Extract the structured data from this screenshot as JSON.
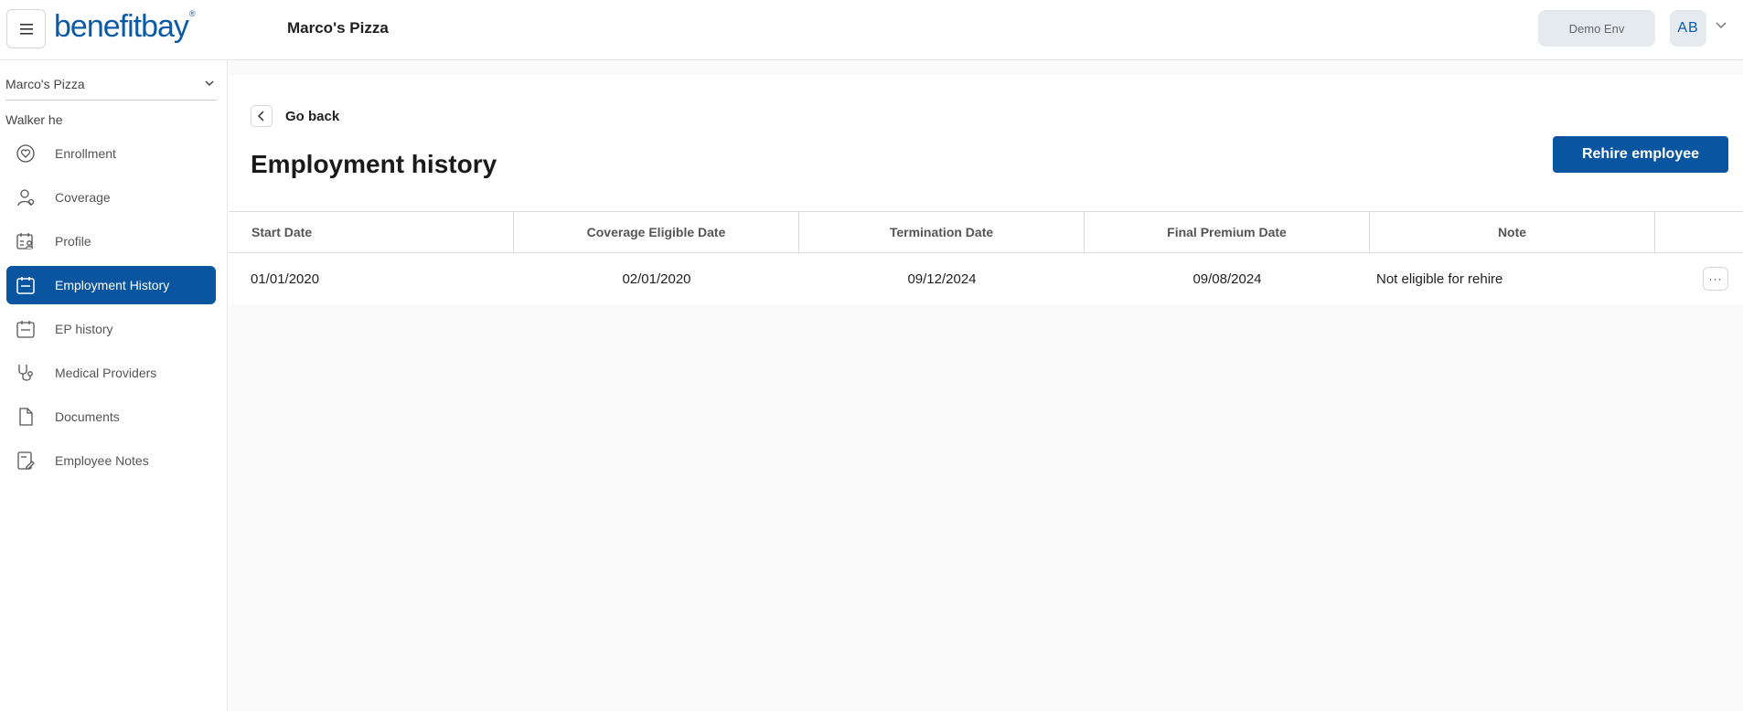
{
  "header": {
    "logo_text": "benefitbay",
    "logo_mark": "®",
    "company_title": "Marco's Pizza",
    "env_label": "Demo Env",
    "avatar_initials": "AB"
  },
  "sidebar": {
    "company_select": "Marco's Pizza",
    "employee_name": "Walker he",
    "items": [
      {
        "label": "Enrollment",
        "icon": "heart-icon",
        "active": false
      },
      {
        "label": "Coverage",
        "icon": "user-icon",
        "active": false
      },
      {
        "label": "Profile",
        "icon": "profile-card-icon",
        "active": false
      },
      {
        "label": "Employment History",
        "icon": "calendar-icon",
        "active": true
      },
      {
        "label": "EP history",
        "icon": "calendar-icon",
        "active": false
      },
      {
        "label": "Medical Providers",
        "icon": "stethoscope-icon",
        "active": false
      },
      {
        "label": "Documents",
        "icon": "document-icon",
        "active": false
      },
      {
        "label": "Employee Notes",
        "icon": "note-edit-icon",
        "active": false
      }
    ]
  },
  "main": {
    "go_back_label": "Go back",
    "page_title": "Employment history",
    "rehire_label": "Rehire employee",
    "table": {
      "columns": [
        "Start Date",
        "Coverage Eligible Date",
        "Termination Date",
        "Final Premium Date",
        "Note"
      ],
      "rows": [
        {
          "start_date": "01/01/2020",
          "coverage_eligible_date": "02/01/2020",
          "termination_date": "09/12/2024",
          "final_premium_date": "09/08/2024",
          "note": "Not eligible for rehire",
          "more": "···"
        }
      ]
    }
  },
  "colors": {
    "brand_blue": "#0a55a0",
    "logo_blue": "#0a5aa6",
    "badge_bg": "#e5eaee"
  }
}
